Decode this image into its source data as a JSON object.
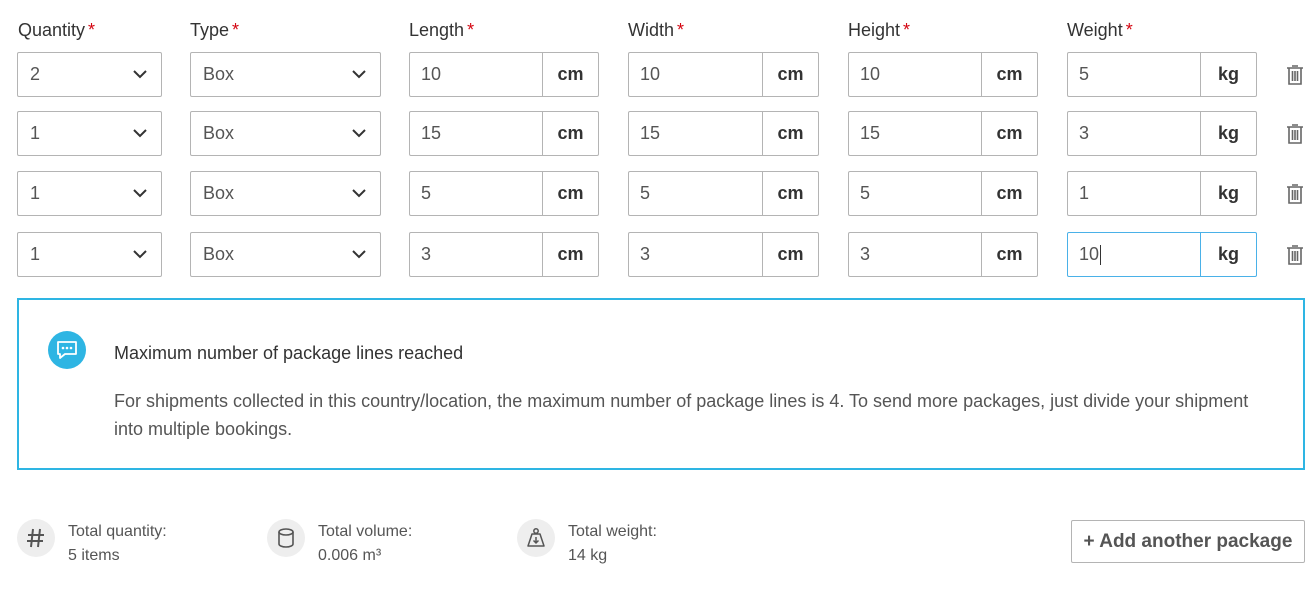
{
  "headers": {
    "quantity": "Quantity",
    "type": "Type",
    "length": "Length",
    "width": "Width",
    "height": "Height",
    "weight": "Weight",
    "required_marker": "*"
  },
  "units": {
    "dimension": "cm",
    "weight": "kg"
  },
  "rows": [
    {
      "quantity": "2",
      "type": "Box",
      "length": "10",
      "width": "10",
      "height": "10",
      "weight": "5"
    },
    {
      "quantity": "1",
      "type": "Box",
      "length": "15",
      "width": "15",
      "height": "15",
      "weight": "3"
    },
    {
      "quantity": "1",
      "type": "Box",
      "length": "5",
      "width": "5",
      "height": "5",
      "weight": "1"
    },
    {
      "quantity": "1",
      "type": "Box",
      "length": "3",
      "width": "3",
      "height": "3",
      "weight": "10"
    }
  ],
  "notice": {
    "title": "Maximum number of package lines reached",
    "text": "For shipments collected in this country/location, the maximum number of package lines is 4. To send more packages, just divide your shipment into multiple bookings.",
    "icon": "chat-bubble-icon"
  },
  "summary": {
    "quantity": {
      "label": "Total quantity:",
      "value": "5 items",
      "icon": "hash-icon"
    },
    "volume": {
      "label": "Total volume:",
      "value": "0.006 m³",
      "icon": "cylinder-icon"
    },
    "weight": {
      "label": "Total weight:",
      "value": "14 kg",
      "icon": "scale-icon"
    }
  },
  "add_button_label": "+ Add another package",
  "colors": {
    "required": "#d40511",
    "accent": "#2eb5e3",
    "focus": "#4ab1e8",
    "border": "#b4b4b4"
  }
}
